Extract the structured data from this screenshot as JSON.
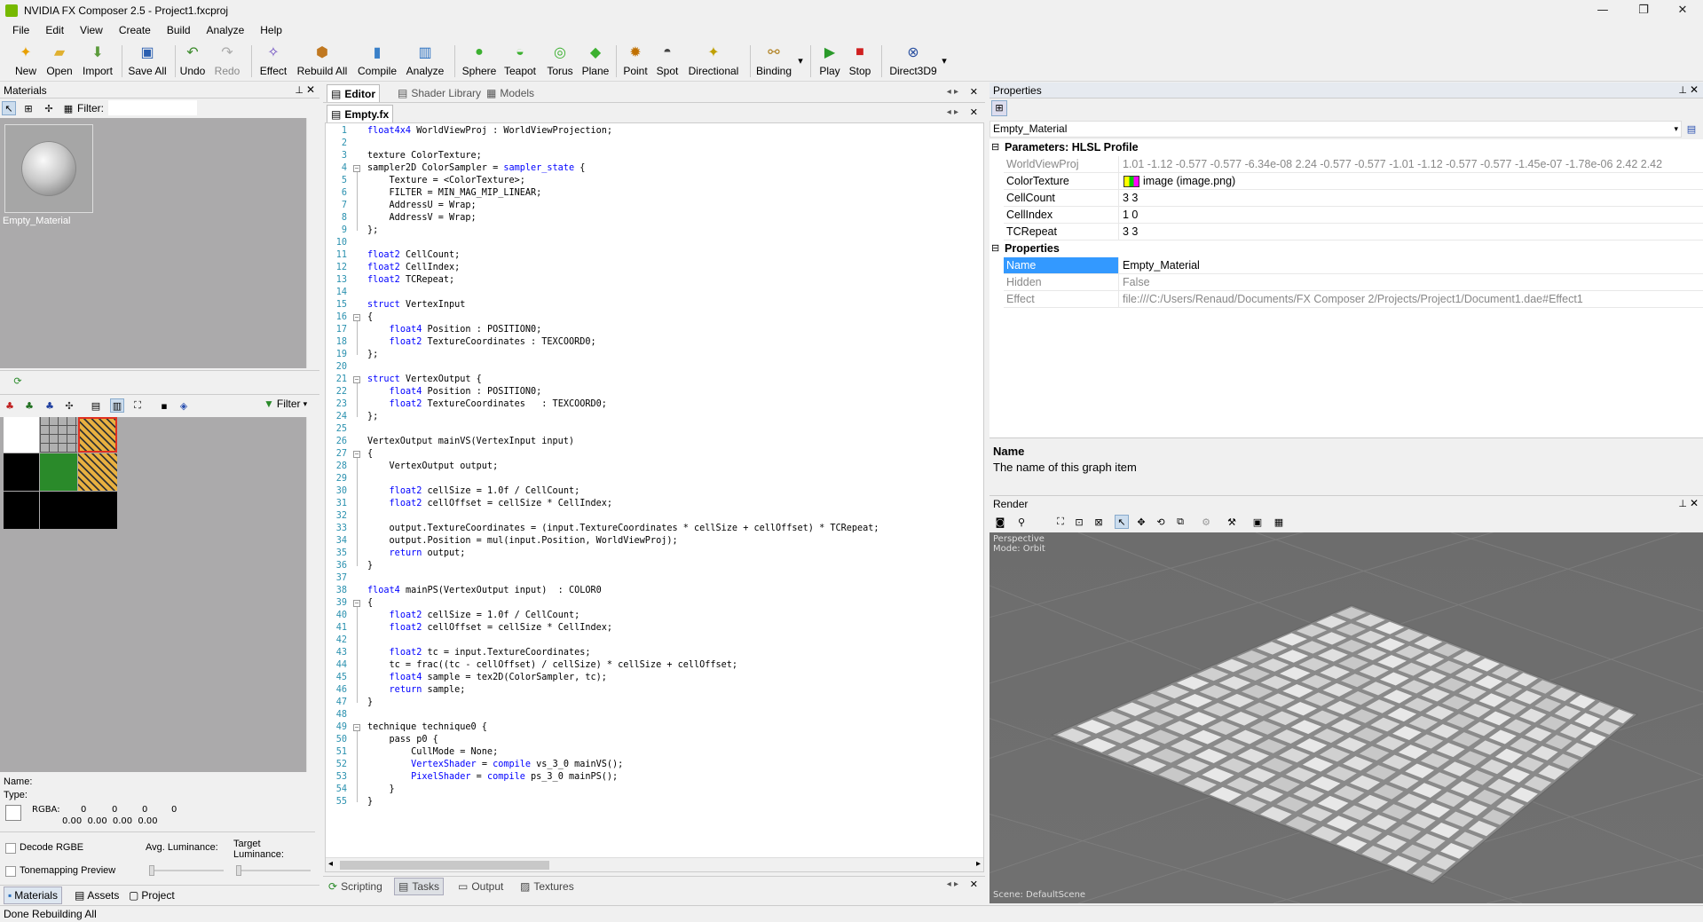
{
  "window": {
    "title": "NVIDIA FX Composer 2.5 - Project1.fxcproj"
  },
  "menu": [
    "File",
    "Edit",
    "View",
    "Create",
    "Build",
    "Analyze",
    "Help"
  ],
  "toolbar": [
    "New",
    "Open",
    "Import",
    "Save All",
    "Undo",
    "Redo",
    "Effect",
    "Rebuild All",
    "Compile",
    "Analyze",
    "Sphere",
    "Teapot",
    "Torus",
    "Plane",
    "Point",
    "Spot",
    "Directional",
    "Binding",
    "Play",
    "Stop",
    "Direct3D9"
  ],
  "materials_panel": {
    "title": "Materials",
    "filter_label": "Filter:",
    "thumbnail_label": "Empty_Material"
  },
  "texture_panel": {
    "filter_label": "Filter",
    "name_label": "Name:",
    "type_label": "Type:",
    "rgba_label": "RGBA:",
    "rgba_top": [
      "0",
      "0",
      "0",
      "0"
    ],
    "rgba_bottom": "0.00 0.00 0.00 0.00",
    "decode_rgbe": "Decode RGBE",
    "tonemapping": "Tonemapping Preview",
    "avg_luminance": "Avg. Luminance:",
    "target_luminance": "Target Luminance:"
  },
  "left_tabs": [
    "Materials",
    "Assets",
    "Project"
  ],
  "editor": {
    "tabs": [
      "Editor",
      "Shader Library",
      "Models"
    ],
    "file_tab": "Empty.fx",
    "lines": [
      {
        "n": "1",
        "t": "float4x4 WorldViewProj : WorldViewProjection;"
      },
      {
        "n": "2",
        "t": ""
      },
      {
        "n": "3",
        "t": "texture ColorTexture;"
      },
      {
        "n": "4",
        "t": "sampler2D ColorSampler = sampler_state {"
      },
      {
        "n": "5",
        "t": "    Texture = <ColorTexture>;"
      },
      {
        "n": "6",
        "t": "    FILTER = MIN_MAG_MIP_LINEAR;"
      },
      {
        "n": "7",
        "t": "    AddressU = Wrap;"
      },
      {
        "n": "8",
        "t": "    AddressV = Wrap;"
      },
      {
        "n": "9",
        "t": "};"
      },
      {
        "n": "10",
        "t": ""
      },
      {
        "n": "11",
        "t": "float2 CellCount;"
      },
      {
        "n": "12",
        "t": "float2 CellIndex;"
      },
      {
        "n": "13",
        "t": "float2 TCRepeat;"
      },
      {
        "n": "14",
        "t": ""
      },
      {
        "n": "15",
        "t": "struct VertexInput"
      },
      {
        "n": "16",
        "t": "{"
      },
      {
        "n": "17",
        "t": "    float4 Position : POSITION0;"
      },
      {
        "n": "18",
        "t": "    float2 TextureCoordinates : TEXCOORD0;"
      },
      {
        "n": "19",
        "t": "};"
      },
      {
        "n": "20",
        "t": ""
      },
      {
        "n": "21",
        "t": "struct VertexOutput {"
      },
      {
        "n": "22",
        "t": "    float4 Position : POSITION0;"
      },
      {
        "n": "23",
        "t": "    float2 TextureCoordinates   : TEXCOORD0;"
      },
      {
        "n": "24",
        "t": "};"
      },
      {
        "n": "25",
        "t": ""
      },
      {
        "n": "26",
        "t": "VertexOutput mainVS(VertexInput input)"
      },
      {
        "n": "27",
        "t": "{"
      },
      {
        "n": "28",
        "t": "    VertexOutput output;"
      },
      {
        "n": "29",
        "t": ""
      },
      {
        "n": "30",
        "t": "    float2 cellSize = 1.0f / CellCount;"
      },
      {
        "n": "31",
        "t": "    float2 cellOffset = cellSize * CellIndex;"
      },
      {
        "n": "32",
        "t": ""
      },
      {
        "n": "33",
        "t": "    output.TextureCoordinates = (input.TextureCoordinates * cellSize + cellOffset) * TCRepeat;"
      },
      {
        "n": "34",
        "t": "    output.Position = mul(input.Position, WorldViewProj);"
      },
      {
        "n": "35",
        "t": "    return output;"
      },
      {
        "n": "36",
        "t": "}"
      },
      {
        "n": "37",
        "t": ""
      },
      {
        "n": "38",
        "t": "float4 mainPS(VertexOutput input)  : COLOR0"
      },
      {
        "n": "39",
        "t": "{"
      },
      {
        "n": "40",
        "t": "    float2 cellSize = 1.0f / CellCount;"
      },
      {
        "n": "41",
        "t": "    float2 cellOffset = cellSize * CellIndex;"
      },
      {
        "n": "42",
        "t": ""
      },
      {
        "n": "43",
        "t": "    float2 tc = input.TextureCoordinates;"
      },
      {
        "n": "44",
        "t": "    tc = frac((tc - cellOffset) / cellSize) * cellSize + cellOffset;"
      },
      {
        "n": "45",
        "t": "    float4 sample = tex2D(ColorSampler, tc);"
      },
      {
        "n": "46",
        "t": "    return sample;"
      },
      {
        "n": "47",
        "t": "}"
      },
      {
        "n": "48",
        "t": ""
      },
      {
        "n": "49",
        "t": "technique technique0 {"
      },
      {
        "n": "50",
        "t": "    pass p0 {"
      },
      {
        "n": "51",
        "t": "        CullMode = None;"
      },
      {
        "n": "52",
        "t": "        VertexShader = compile vs_3_0 mainVS();"
      },
      {
        "n": "53",
        "t": "        PixelShader = compile ps_3_0 mainPS();"
      },
      {
        "n": "54",
        "t": "    }"
      },
      {
        "n": "55",
        "t": "}"
      }
    ],
    "bottom_tabs": [
      "Scripting",
      "Tasks",
      "Output",
      "Textures"
    ]
  },
  "properties": {
    "title": "Properties",
    "selector": "Empty_Material",
    "section1": "Parameters: HLSL Profile",
    "params": [
      {
        "name": "WorldViewProj",
        "value": "1.01 -1.12 -0.577 -0.577 -6.34e-08 2.24 -0.577 -0.577 -1.01 -1.12 -0.577 -0.577 -1.45e-07 -1.78e-06 2.42 2.42"
      },
      {
        "name": "ColorTexture",
        "value": "image (image.png)"
      },
      {
        "name": "CellCount",
        "value": "3 3"
      },
      {
        "name": "CellIndex",
        "value": "1 0"
      },
      {
        "name": "TCRepeat",
        "value": "3 3"
      }
    ],
    "section2": "Properties",
    "props": [
      {
        "name": "Name",
        "value": "Empty_Material"
      },
      {
        "name": "Hidden",
        "value": "False"
      },
      {
        "name": "Effect",
        "value": "file:///C:/Users/Renaud/Documents/FX Composer 2/Projects/Project1/Document1.dae#Effect1"
      }
    ],
    "desc_title": "Name",
    "desc_text": "The name of this graph item"
  },
  "render": {
    "title": "Render",
    "overlay1": "Perspective",
    "overlay2": "Mode: Orbit",
    "scene": "Scene: DefaultScene"
  },
  "status": "Done Rebuilding All"
}
